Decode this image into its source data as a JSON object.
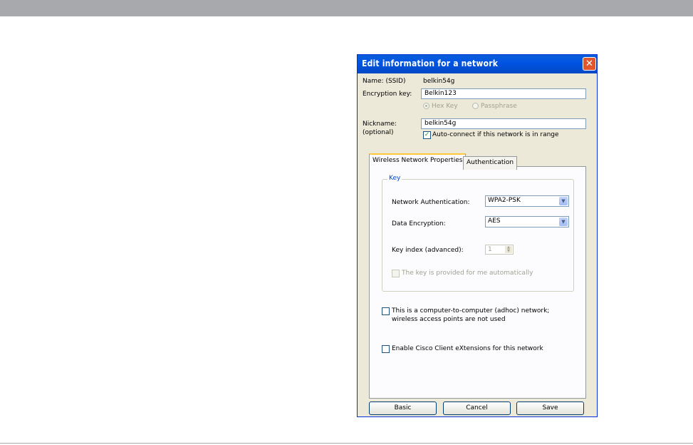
{
  "dialog": {
    "title": "Edit information for a network",
    "close_glyph": "✕",
    "ssid_label": "Name:  (SSID)",
    "ssid_value": "belkin54g",
    "encryption_key_label": "Encryption key:",
    "encryption_key_value": "Belkin123",
    "radio_hex": "Hex Key",
    "radio_passphrase": "Passphrase",
    "nickname_label": "Nickname:",
    "nickname_optional": "(optional)",
    "nickname_value": "belkin54g",
    "autoconnect_label": "Auto-connect if this network is in range",
    "autoconnect_checked": true,
    "checkmark": "✓"
  },
  "tabs": {
    "wireless": "Wireless Network Properties",
    "authentication": "Authentication"
  },
  "key_group": {
    "legend": "Key",
    "network_auth_label": "Network Authentication:",
    "network_auth_value": "WPA2-PSK",
    "data_encryption_label": "Data Encryption:",
    "data_encryption_value": "AES",
    "key_index_label": "Key index (advanced):",
    "key_index_value": "1",
    "auto_key_label": "The key is provided for me automatically",
    "dropdown_glyph": "▼"
  },
  "options": {
    "adhoc_line1": "This is a computer-to-computer (adhoc) network;",
    "adhoc_line2": "wireless access points are not used",
    "cisco_label": "Enable Cisco Client eXtensions for this network"
  },
  "buttons": {
    "basic": "Basic",
    "cancel": "Cancel",
    "save": "Save"
  },
  "colors": {
    "title_bar": "#0054e3",
    "close_button": "#e2552d",
    "dialog_bg": "#ece9d8",
    "tab_highlight": "#ffc83c"
  }
}
